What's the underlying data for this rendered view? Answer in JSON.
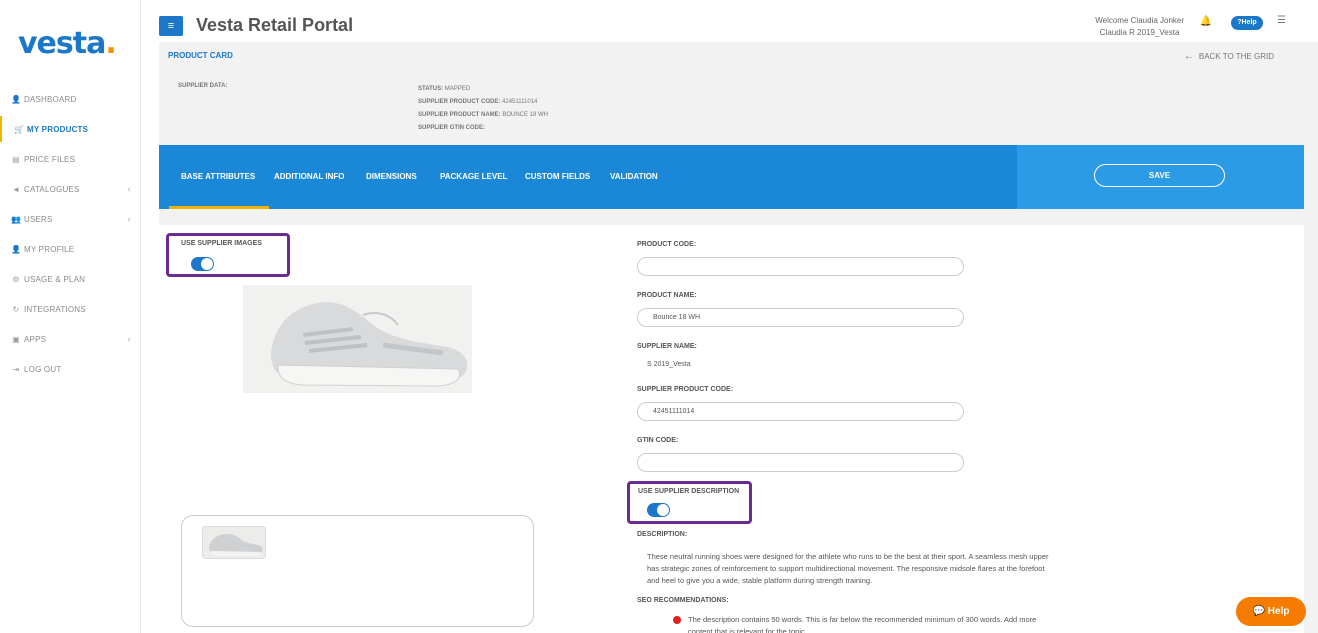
{
  "logo": {
    "text": "vesta",
    "dot": "."
  },
  "nav": [
    {
      "icon": "person-icon",
      "glyph": "👤",
      "label": "DASHBOARD",
      "active": false,
      "chevron": ""
    },
    {
      "icon": "cart-icon",
      "glyph": "🛒",
      "label": "MY PRODUCTS",
      "active": true,
      "chevron": ""
    },
    {
      "icon": "file-icon",
      "glyph": "▤",
      "label": "PRICE FILES",
      "active": false,
      "chevron": ""
    },
    {
      "icon": "megaphone-icon",
      "glyph": "◄",
      "label": "CATALOGUES",
      "active": false,
      "chevron": "‹"
    },
    {
      "icon": "users-icon",
      "glyph": "👥",
      "label": "USERS",
      "active": false,
      "chevron": "‹"
    },
    {
      "icon": "person-icon",
      "glyph": "👤",
      "label": "MY PROFILE",
      "active": false,
      "chevron": ""
    },
    {
      "icon": "gear-icon",
      "glyph": "⚙",
      "label": "USAGE & PLAN",
      "active": false,
      "chevron": ""
    },
    {
      "icon": "sync-icon",
      "glyph": "↻",
      "label": "INTEGRATIONS",
      "active": false,
      "chevron": ""
    },
    {
      "icon": "apps-icon",
      "glyph": "▣",
      "label": "APPS",
      "active": false,
      "chevron": "‹"
    },
    {
      "icon": "logout-icon",
      "glyph": "⇥",
      "label": "LOG OUT",
      "active": false,
      "chevron": ""
    }
  ],
  "header": {
    "title": "Vesta Retail Portal",
    "welcome_line1": "Welcome Claudia Jonker",
    "welcome_line2": "Claudia R 2019_Vesta",
    "help_label": "?Help"
  },
  "product_card": {
    "title": "PRODUCT CARD",
    "back_label": "BACK TO THE GRID",
    "supplier_data_label": "SUPPLIER DATA:",
    "status_label": "STATUS:",
    "status_value": "MAPPED",
    "supplier_code_label": "SUPPLIER PRODUCT CODE:",
    "supplier_code_value": "42451111014",
    "supplier_name_label": "SUPPLIER PRODUCT NAME:",
    "supplier_name_value": "BOUNCE 18 WH",
    "gtin_label": "SUPPLIER GTIN CODE:",
    "gtin_value": ""
  },
  "tabs": [
    {
      "label": "BASE ATTRIBUTES",
      "active": true
    },
    {
      "label": "ADDITIONAL INFO",
      "active": false
    },
    {
      "label": "DIMENSIONS",
      "active": false
    },
    {
      "label": "PACKAGE LEVEL",
      "active": false
    },
    {
      "label": "CUSTOM FIELDS",
      "active": false
    },
    {
      "label": "VALIDATION",
      "active": false
    }
  ],
  "save_label": "SAVE",
  "form": {
    "use_supplier_images_label": "USE SUPPLIER IMAGES",
    "use_supplier_images": true,
    "product_code_label": "PRODUCT CODE:",
    "product_code_value": "",
    "product_name_label": "PRODUCT NAME:",
    "product_name_value": "Bounce 18 WH",
    "supplier_name_label": "SUPPLIER NAME:",
    "supplier_name_value": "S 2019_Vesta",
    "supplier_product_code_label": "SUPPLIER PRODUCT CODE:",
    "supplier_product_code_value": "42451111014",
    "gtin_code_label": "GTIN CODE:",
    "gtin_code_value": "",
    "use_supplier_description_label": "USE SUPPLIER DESCRIPTION",
    "use_supplier_description": true,
    "description_label": "DESCRIPTION:",
    "description_text": "These neutral running shoes were designed for the athlete who runs to be the best at their sport. A seamless mesh upper has strategic zones of reinforcement to support multidirectional movement. The responsive midsole flares at the forefoot and heel to give you a wide, stable platform during strength training.",
    "seo_label": "SEO RECOMMENDATIONS:",
    "seo_text": "The description contains 50 words. This is far below the recommended minimum of 300 words. Add more content that is relevant for the topic."
  },
  "help_float_label": "Help",
  "colors": {
    "brand": "#1a77c9",
    "accent": "#f3b400",
    "highlight_outline": "#6a2a93",
    "help_button": "#f57c00",
    "seo_error": "#e02020"
  }
}
